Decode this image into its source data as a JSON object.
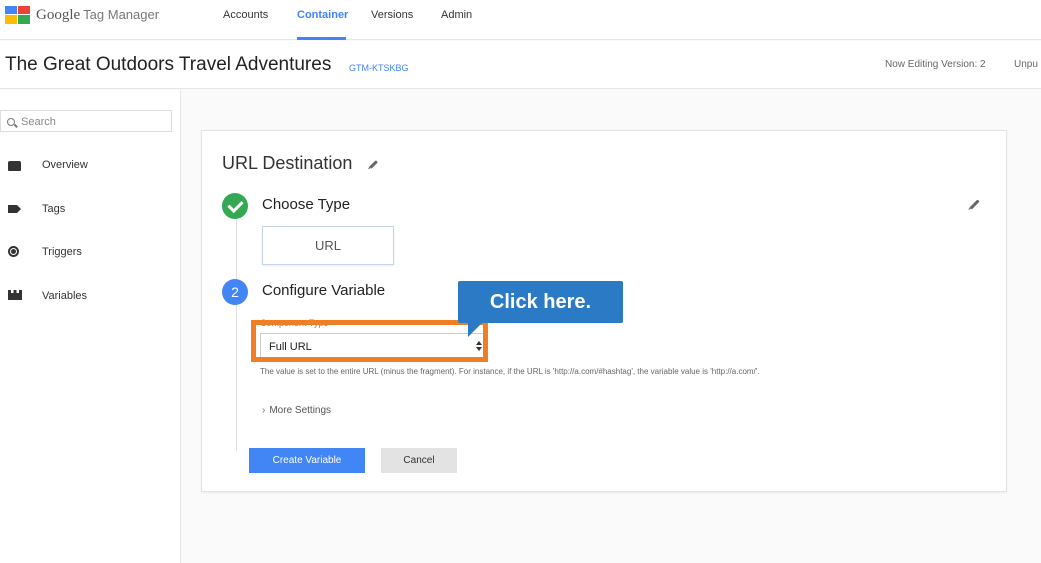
{
  "app": {
    "brand": "Google",
    "product": "Tag Manager",
    "tabs": [
      {
        "label": "Accounts",
        "active": false
      },
      {
        "label": "Container",
        "active": true
      },
      {
        "label": "Versions",
        "active": false
      },
      {
        "label": "Admin",
        "active": false
      }
    ]
  },
  "container": {
    "name": "The Great Outdoors Travel Adventures",
    "id": "GTM-KTSKBG",
    "version_text": "Now Editing Version: 2",
    "status_truncated": "Unpu"
  },
  "sidebar": {
    "search_placeholder": "Search",
    "items": [
      {
        "label": "Overview",
        "icon": "folder-icon"
      },
      {
        "label": "Tags",
        "icon": "tag-icon"
      },
      {
        "label": "Triggers",
        "icon": "trigger-icon"
      },
      {
        "label": "Variables",
        "icon": "variables-icon",
        "active": true
      }
    ]
  },
  "editor": {
    "title": "URL Destination",
    "step1": {
      "title": "Choose Type",
      "value": "URL"
    },
    "step2": {
      "number": "2",
      "title": "Configure Variable",
      "field_label": "Component Type",
      "selected": "Full URL",
      "help": "The value is set to the entire URL (minus the fragment). For instance, if the URL is 'http://a.com/#hashtag', the variable value is 'http://a.com/'.",
      "more_settings": "More Settings"
    },
    "buttons": {
      "create": "Create Variable",
      "cancel": "Cancel"
    }
  },
  "tutorial": {
    "callout": "Click here.",
    "highlight_color": "#f07f23",
    "callout_color": "#2a7ac5"
  },
  "colors": {
    "accent": "#4285f4",
    "success": "#34a853"
  }
}
